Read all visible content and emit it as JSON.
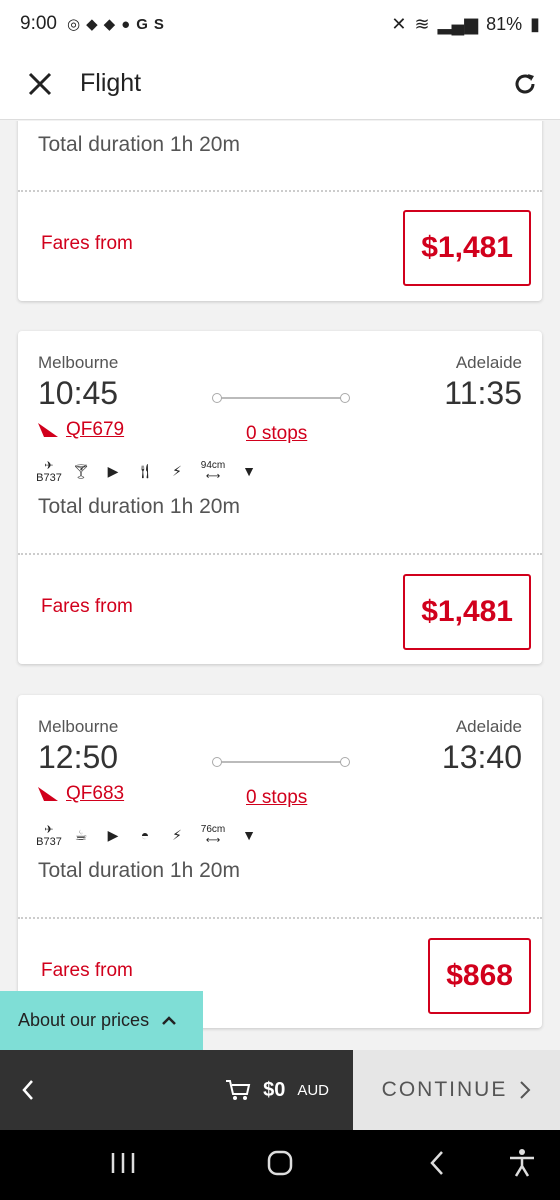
{
  "status_bar": {
    "time": "9:00",
    "battery": "81%"
  },
  "header": {
    "title": "Flight"
  },
  "flights": [
    {
      "duration": "Total duration 1h 20m",
      "fares_label": "Fares from",
      "price": "$1,481"
    },
    {
      "from_city": "Melbourne",
      "to_city": "Adelaide",
      "depart": "10:45",
      "arrive": "11:35",
      "flight_no": "QF679",
      "stops": "0 stops",
      "aircraft": "B737",
      "seat_pitch": "94cm",
      "duration": "Total duration 1h 20m",
      "fares_label": "Fares from",
      "price": "$1,481"
    },
    {
      "from_city": "Melbourne",
      "to_city": "Adelaide",
      "depart": "12:50",
      "arrive": "13:40",
      "flight_no": "QF683",
      "stops": "0 stops",
      "aircraft": "B737",
      "seat_pitch": "76cm",
      "duration": "Total duration 1h 20m",
      "fares_label": "Fares from",
      "price": "$868"
    }
  ],
  "about_prices": "About our prices",
  "bottom_bar": {
    "total": "$0",
    "currency": "AUD",
    "continue_label": "CONTINUE"
  },
  "colors": {
    "brand_red": "#d1001c",
    "teal": "#7fded6",
    "dark_bar": "#323232"
  }
}
